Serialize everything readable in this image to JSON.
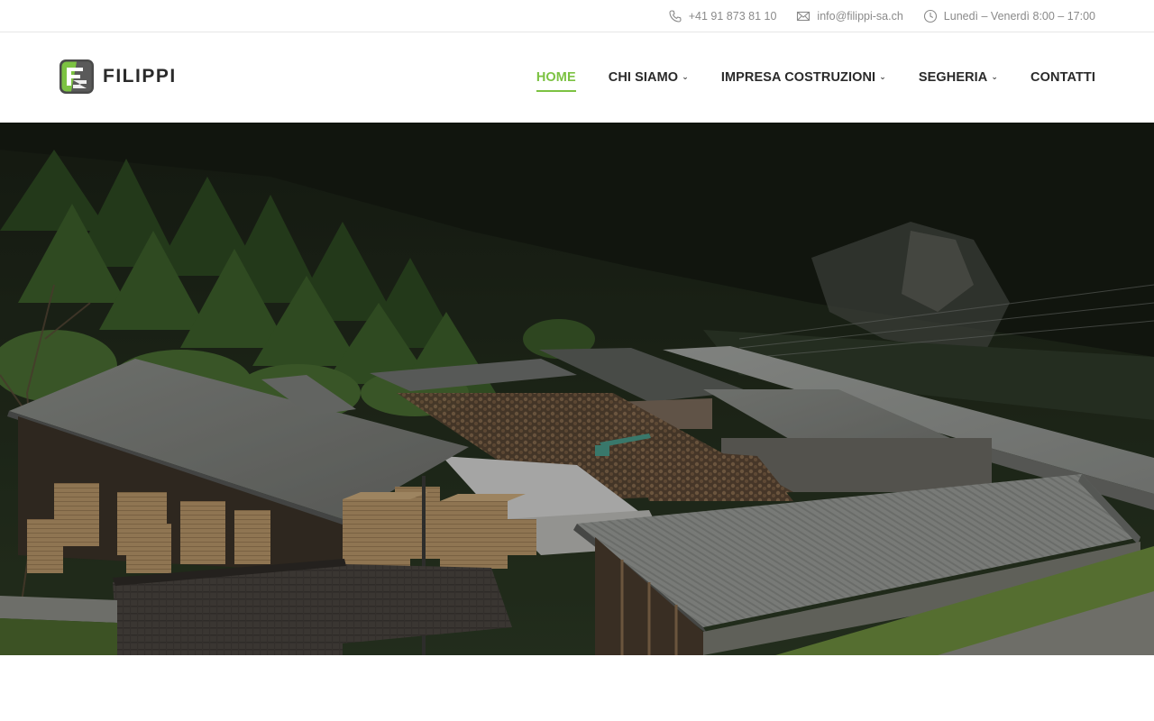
{
  "topbar": {
    "phone": {
      "icon": "phone-icon",
      "text": "+41 91 873 81 10"
    },
    "email": {
      "icon": "mail-icon",
      "text": "info@filippi-sa.ch"
    },
    "hours": {
      "icon": "clock-icon",
      "text": "Lunedì – Venerdì 8:00 – 17:00"
    }
  },
  "header": {
    "logo_text": "FILIPPI",
    "nav": [
      {
        "label": "HOME",
        "active": true,
        "dropdown": false
      },
      {
        "label": "CHI SIAMO",
        "active": false,
        "dropdown": true
      },
      {
        "label": "IMPRESA COSTRUZIONI",
        "active": false,
        "dropdown": true
      },
      {
        "label": "SEGHERIA",
        "active": false,
        "dropdown": true
      },
      {
        "label": "CONTATTI",
        "active": false,
        "dropdown": false
      }
    ]
  },
  "colors": {
    "accent": "#7cc242",
    "nav_text": "#2a2a2a",
    "topbar_text": "#8a8a8a"
  },
  "hero": {
    "image": "sawmill-valley-photo"
  }
}
